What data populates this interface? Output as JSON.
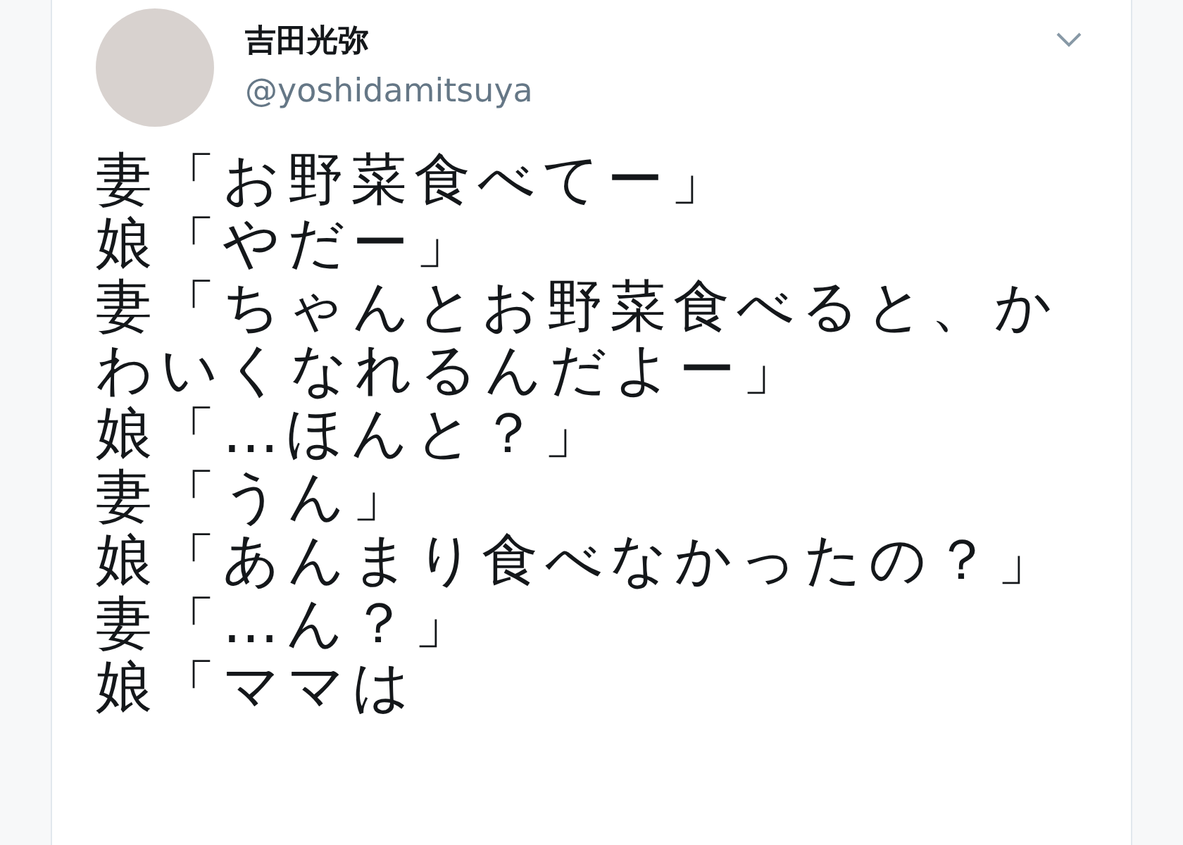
{
  "tweet": {
    "author": {
      "name": "吉田光弥",
      "handle": "@yoshidamitsuya"
    },
    "lines": [
      "妻「お野菜食べてー」",
      "娘「やだー」",
      "妻「ちゃんとお野菜食べると、かわいくなれるんだよー」",
      "娘「…ほんと？」",
      "妻「うん」",
      "娘「あんまり食べなかったの？」",
      "妻「…ん？」",
      "娘「ママは"
    ]
  }
}
